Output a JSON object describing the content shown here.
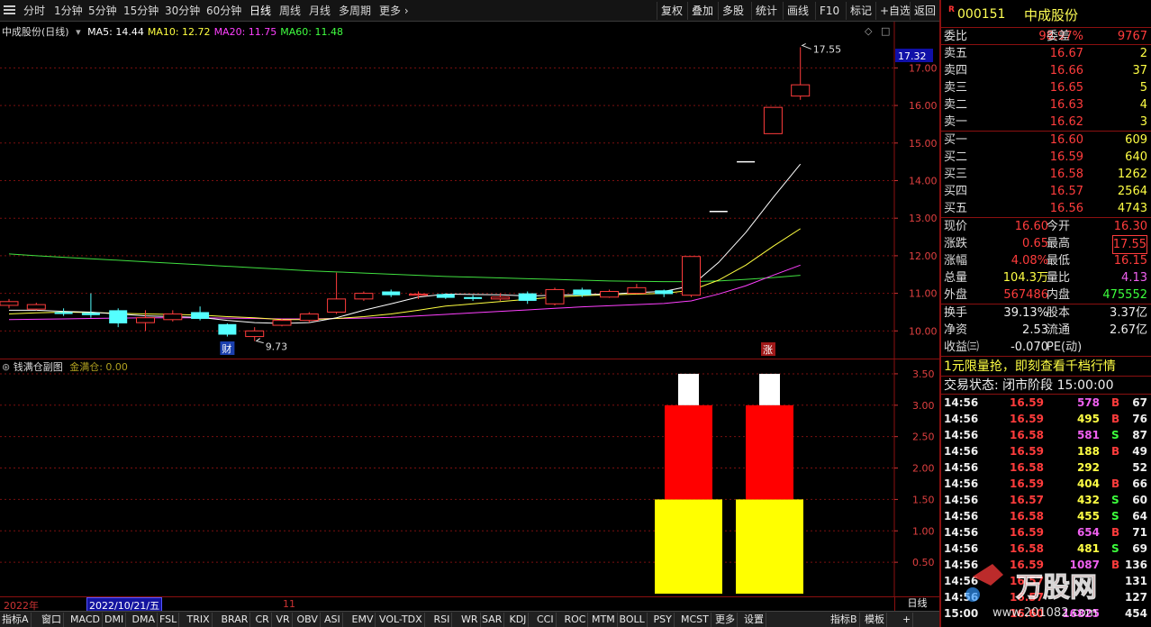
{
  "toolbar": {
    "periods": [
      "分时",
      "1分钟",
      "5分钟",
      "15分钟",
      "30分钟",
      "60分钟",
      "日线",
      "周线",
      "月线",
      "多周期",
      "更多"
    ],
    "active_period": "日线",
    "buttons": [
      "复权",
      "叠加",
      "多股",
      "统计",
      "画线",
      "F10",
      "标记",
      "+自选",
      "返回"
    ]
  },
  "main_chart": {
    "title": "中成股份(日线)",
    "ma": [
      {
        "label": "MA5: 14.44",
        "color": "#ffffff"
      },
      {
        "label": "MA10: 12.72",
        "color": "#ffff40"
      },
      {
        "label": "MA20: 11.75",
        "color": "#ff40ff"
      },
      {
        "label": "MA60: 11.48",
        "color": "#40ff40"
      }
    ],
    "price_ticks": [
      "17.00",
      "16.00",
      "15.00",
      "14.00",
      "13.00",
      "12.00",
      "11.00",
      "10.00"
    ],
    "current_price_label": "17.32",
    "high_label": "17.55",
    "low_label": "9.73",
    "markers": {
      "cai": "财",
      "zhang": "涨"
    }
  },
  "chart_data": [
    {
      "type": "candlestick",
      "title": "中成股份(日线)",
      "ylim": [
        9.6,
        17.8
      ],
      "candles": [
        {
          "o": 10.68,
          "c": 10.78,
          "h": 10.85,
          "l": 10.6
        },
        {
          "o": 10.58,
          "c": 10.7,
          "h": 10.75,
          "l": 10.55
        },
        {
          "o": 10.5,
          "c": 10.45,
          "h": 10.6,
          "l": 10.4
        },
        {
          "o": 10.48,
          "c": 10.42,
          "h": 11.0,
          "l": 10.35
        },
        {
          "o": 10.55,
          "c": 10.2,
          "h": 10.6,
          "l": 10.1
        },
        {
          "o": 10.22,
          "c": 10.35,
          "h": 10.55,
          "l": 10.0
        },
        {
          "o": 10.3,
          "c": 10.45,
          "h": 10.55,
          "l": 10.25
        },
        {
          "o": 10.5,
          "c": 10.32,
          "h": 10.65,
          "l": 10.28
        },
        {
          "o": 10.18,
          "c": 9.9,
          "h": 10.2,
          "l": 9.85
        },
        {
          "o": 9.85,
          "c": 10.0,
          "h": 10.1,
          "l": 9.73
        },
        {
          "o": 10.15,
          "c": 10.28,
          "h": 10.32,
          "l": 10.12
        },
        {
          "o": 10.28,
          "c": 10.45,
          "h": 10.5,
          "l": 10.22
        },
        {
          "o": 10.5,
          "c": 10.85,
          "h": 11.55,
          "l": 10.45
        },
        {
          "o": 10.85,
          "c": 11.0,
          "h": 11.05,
          "l": 10.8
        },
        {
          "o": 11.05,
          "c": 10.95,
          "h": 11.1,
          "l": 10.9
        },
        {
          "o": 10.95,
          "c": 10.98,
          "h": 11.05,
          "l": 10.85
        },
        {
          "o": 10.98,
          "c": 10.88,
          "h": 11.0,
          "l": 10.85
        },
        {
          "o": 10.9,
          "c": 10.85,
          "h": 10.95,
          "l": 10.8
        },
        {
          "o": 10.85,
          "c": 10.9,
          "h": 11.0,
          "l": 10.8
        },
        {
          "o": 11.0,
          "c": 10.8,
          "h": 11.05,
          "l": 10.72
        },
        {
          "o": 10.72,
          "c": 11.1,
          "h": 11.15,
          "l": 10.68
        },
        {
          "o": 11.1,
          "c": 10.95,
          "h": 11.15,
          "l": 10.9
        },
        {
          "o": 10.9,
          "c": 11.05,
          "h": 11.1,
          "l": 10.88
        },
        {
          "o": 11.0,
          "c": 11.15,
          "h": 11.25,
          "l": 10.98
        },
        {
          "o": 11.08,
          "c": 10.98,
          "h": 11.1,
          "l": 10.9
        },
        {
          "o": 10.95,
          "c": 11.98,
          "h": 11.98,
          "l": 10.9
        },
        {
          "o": 13.18,
          "c": 13.18,
          "h": 13.18,
          "l": 13.18
        },
        {
          "o": 14.5,
          "c": 14.5,
          "h": 14.5,
          "l": 14.5
        },
        {
          "o": 15.25,
          "c": 15.95,
          "h": 15.95,
          "l": 15.25
        },
        {
          "o": 16.25,
          "c": 16.55,
          "h": 17.55,
          "l": 16.15
        }
      ],
      "ma5": [
        10.55,
        10.55,
        10.52,
        10.5,
        10.45,
        10.4,
        10.38,
        10.36,
        10.28,
        10.22,
        10.2,
        10.22,
        10.35,
        10.55,
        10.72,
        10.9,
        10.98,
        10.97,
        10.96,
        10.93,
        10.95,
        10.97,
        10.98,
        11.02,
        11.05,
        11.2,
        11.82,
        12.62,
        13.55,
        14.44
      ],
      "ma10": [
        10.45,
        10.48,
        10.5,
        10.49,
        10.47,
        10.45,
        10.44,
        10.42,
        10.38,
        10.35,
        10.3,
        10.3,
        10.33,
        10.38,
        10.45,
        10.55,
        10.66,
        10.72,
        10.78,
        10.84,
        10.9,
        10.94,
        10.96,
        10.98,
        11.0,
        11.08,
        11.35,
        11.75,
        12.25,
        12.72
      ],
      "ma20": [
        10.3,
        10.31,
        10.32,
        10.33,
        10.34,
        10.35,
        10.35,
        10.35,
        10.34,
        10.33,
        10.32,
        10.32,
        10.33,
        10.34,
        10.36,
        10.4,
        10.44,
        10.48,
        10.52,
        10.56,
        10.6,
        10.64,
        10.67,
        10.7,
        10.73,
        10.8,
        10.98,
        11.2,
        11.48,
        11.75
      ],
      "ma60": [
        12.05,
        12.0,
        11.96,
        11.92,
        11.88,
        11.84,
        11.8,
        11.76,
        11.72,
        11.68,
        11.64,
        11.6,
        11.57,
        11.54,
        11.51,
        11.48,
        11.45,
        11.43,
        11.41,
        11.39,
        11.37,
        11.35,
        11.33,
        11.32,
        11.31,
        11.31,
        11.33,
        11.37,
        11.42,
        11.48
      ]
    },
    {
      "type": "bar",
      "title": "钱满仓副图",
      "ylim": [
        0,
        3.7
      ],
      "yticks": [
        "3.50",
        "3.00",
        "2.50",
        "2.00",
        "1.50",
        "1.00",
        "0.50"
      ],
      "groups": [
        {
          "yellow": 1.5,
          "red": [
            1.5,
            3.0
          ],
          "white": [
            3.0,
            3.5
          ]
        },
        {
          "yellow": 1.5,
          "red": [
            1.5,
            3.0
          ],
          "white": [
            3.0,
            3.5
          ]
        }
      ]
    }
  ],
  "sub_chart": {
    "title": "钱满仓副图",
    "value_label": "金满仓: 0.00",
    "ticks": [
      "3.50",
      "3.00",
      "2.50",
      "2.00",
      "1.50",
      "1.00",
      "0.50"
    ]
  },
  "date_axis": {
    "year": "2022年",
    "selected_date": "2022/10/21/五",
    "month": "11",
    "right_label": "日线"
  },
  "bottom_tabs": [
    "指标A",
    "窗口",
    "MACD",
    "DMI",
    "DMA",
    "FSL",
    "TRIX",
    "BRAR",
    "CR",
    "VR",
    "OBV",
    "ASI",
    "EMV",
    "VOL-TDX",
    "RSI",
    "WR",
    "SAR",
    "KDJ",
    "CCI",
    "ROC",
    "MTM",
    "BOLL",
    "PSY",
    "MCST",
    "更多",
    "设置"
  ],
  "bottom_right_tabs": [
    "指标B",
    "模板",
    "+"
  ],
  "quote": {
    "code": "000151",
    "name": "中成股份",
    "weibi_label": "委比",
    "weibi": "98.97%",
    "weicha_label": "委差",
    "weicha": "9767",
    "asks": [
      {
        "label": "卖五",
        "price": "16.67",
        "vol": "2"
      },
      {
        "label": "卖四",
        "price": "16.66",
        "vol": "37"
      },
      {
        "label": "卖三",
        "price": "16.65",
        "vol": "5"
      },
      {
        "label": "卖二",
        "price": "16.63",
        "vol": "4"
      },
      {
        "label": "卖一",
        "price": "16.62",
        "vol": "3"
      }
    ],
    "bids": [
      {
        "label": "买一",
        "price": "16.60",
        "vol": "609"
      },
      {
        "label": "买二",
        "price": "16.59",
        "vol": "640"
      },
      {
        "label": "买三",
        "price": "16.58",
        "vol": "1262"
      },
      {
        "label": "买四",
        "price": "16.57",
        "vol": "2564"
      },
      {
        "label": "买五",
        "price": "16.56",
        "vol": "4743"
      }
    ],
    "stats": [
      {
        "l1": "现价",
        "v1": "16.60",
        "c1": "red",
        "l2": "今开",
        "v2": "16.30",
        "c2": "red"
      },
      {
        "l1": "涨跌",
        "v1": "0.65",
        "c1": "red",
        "l2": "最高",
        "v2": "17.55",
        "c2": "red"
      },
      {
        "l1": "涨幅",
        "v1": "4.08%",
        "c1": "red",
        "l2": "最低",
        "v2": "16.15",
        "c2": "red"
      },
      {
        "l1": "总量",
        "v1": "104.3万",
        "c1": "yellow",
        "l2": "量比",
        "v2": "4.13",
        "c2": "magenta"
      },
      {
        "l1": "外盘",
        "v1": "567486",
        "c1": "red",
        "l2": "内盘",
        "v2": "475552",
        "c2": "green"
      }
    ],
    "stats2": [
      {
        "l1": "换手",
        "v1": "39.13%",
        "c1": "white",
        "l2": "股本",
        "v2": "3.37亿",
        "c2": "white"
      },
      {
        "l1": "净资",
        "v1": "2.53",
        "c1": "white",
        "l2": "流通",
        "v2": "2.67亿",
        "c2": "white"
      },
      {
        "l1": "收益㈢",
        "v1": "-0.070",
        "c1": "white",
        "l2": "PE(动)",
        "v2": "",
        "c2": "white"
      }
    ],
    "promo": "1元限量抢，即刻查看千档行情",
    "trade_status": "交易状态: 闭市阶段 15:00:00"
  },
  "ticks": [
    {
      "time": "14:56",
      "price": "16.59",
      "vol": "578",
      "bs": "B",
      "n": "67",
      "vc": "magenta"
    },
    {
      "time": "14:56",
      "price": "16.59",
      "vol": "495",
      "bs": "B",
      "n": "76",
      "vc": "yellow"
    },
    {
      "time": "14:56",
      "price": "16.58",
      "vol": "581",
      "bs": "S",
      "n": "87",
      "vc": "magenta"
    },
    {
      "time": "14:56",
      "price": "16.59",
      "vol": "188",
      "bs": "B",
      "n": "49",
      "vc": "yellow"
    },
    {
      "time": "14:56",
      "price": "16.58",
      "vol": "292",
      "bs": "",
      "n": "52",
      "vc": "yellow"
    },
    {
      "time": "14:56",
      "price": "16.59",
      "vol": "404",
      "bs": "B",
      "n": "66",
      "vc": "yellow"
    },
    {
      "time": "14:56",
      "price": "16.57",
      "vol": "432",
      "bs": "S",
      "n": "60",
      "vc": "yellow"
    },
    {
      "time": "14:56",
      "price": "16.58",
      "vol": "455",
      "bs": "S",
      "n": "64",
      "vc": "yellow"
    },
    {
      "time": "14:56",
      "price": "16.59",
      "vol": "654",
      "bs": "B",
      "n": "71",
      "vc": "magenta"
    },
    {
      "time": "14:56",
      "price": "16.58",
      "vol": "481",
      "bs": "S",
      "n": "69",
      "vc": "yellow"
    },
    {
      "time": "14:56",
      "price": "16.59",
      "vol": "1087",
      "bs": "B",
      "n": "136",
      "vc": "magenta"
    },
    {
      "time": "14:56",
      "price": "16.57",
      "vol": "",
      "bs": "",
      "n": "131",
      "vc": "yellow"
    },
    {
      "time": "14:56",
      "price": "16.57",
      "vol": "",
      "bs": "",
      "n": "127",
      "vc": "yellow"
    },
    {
      "time": "15:00",
      "price": "16.60",
      "vol": "16825",
      "bs": "",
      "n": "454",
      "vc": "magenta"
    }
  ],
  "watermark": {
    "text": "万股网",
    "url": "www.201082.com"
  },
  "colors": {
    "up": "#ff3c3c",
    "down": "#54ffff",
    "grid": "#7a0f0f",
    "border": "#8b1010"
  }
}
